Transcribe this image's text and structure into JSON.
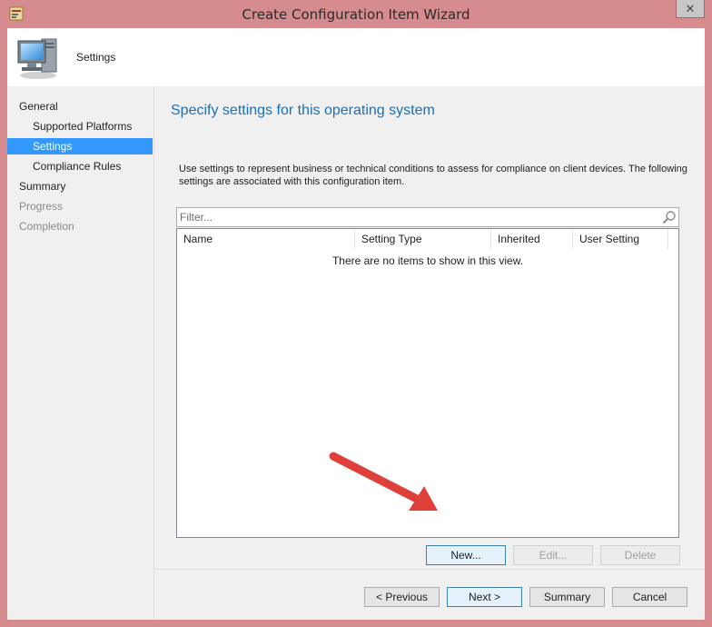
{
  "window": {
    "title": "Create Configuration Item Wizard",
    "close_glyph": "✕"
  },
  "header": {
    "title": "Settings",
    "icon": "computer-icon"
  },
  "nav": {
    "items": [
      {
        "label": "General",
        "level": "top",
        "state": "normal"
      },
      {
        "label": "Supported Platforms",
        "level": "sub",
        "state": "normal"
      },
      {
        "label": "Settings",
        "level": "sub",
        "state": "selected"
      },
      {
        "label": "Compliance Rules",
        "level": "sub",
        "state": "normal"
      },
      {
        "label": "Summary",
        "level": "top",
        "state": "normal"
      },
      {
        "label": "Progress",
        "level": "top",
        "state": "disabled"
      },
      {
        "label": "Completion",
        "level": "top",
        "state": "disabled"
      }
    ]
  },
  "main": {
    "heading": "Specify settings for this operating system",
    "description": "Use settings to represent business or technical conditions to assess for compliance on client devices. The following settings are associated with this configuration item.",
    "filter_placeholder": "Filter...",
    "columns": [
      "Name",
      "Setting Type",
      "Inherited",
      "User Setting"
    ],
    "empty_message": "There are no items to show in this view.",
    "list_buttons": {
      "new": "New...",
      "edit": "Edit...",
      "delete": "Delete"
    }
  },
  "footer": {
    "previous": "< Previous",
    "next": "Next >",
    "summary": "Summary",
    "cancel": "Cancel"
  },
  "colors": {
    "accent": "#3399ff",
    "heading": "#1e6fb2",
    "window_frame": "#d68b8f",
    "annotation_arrow": "#e0403a"
  }
}
